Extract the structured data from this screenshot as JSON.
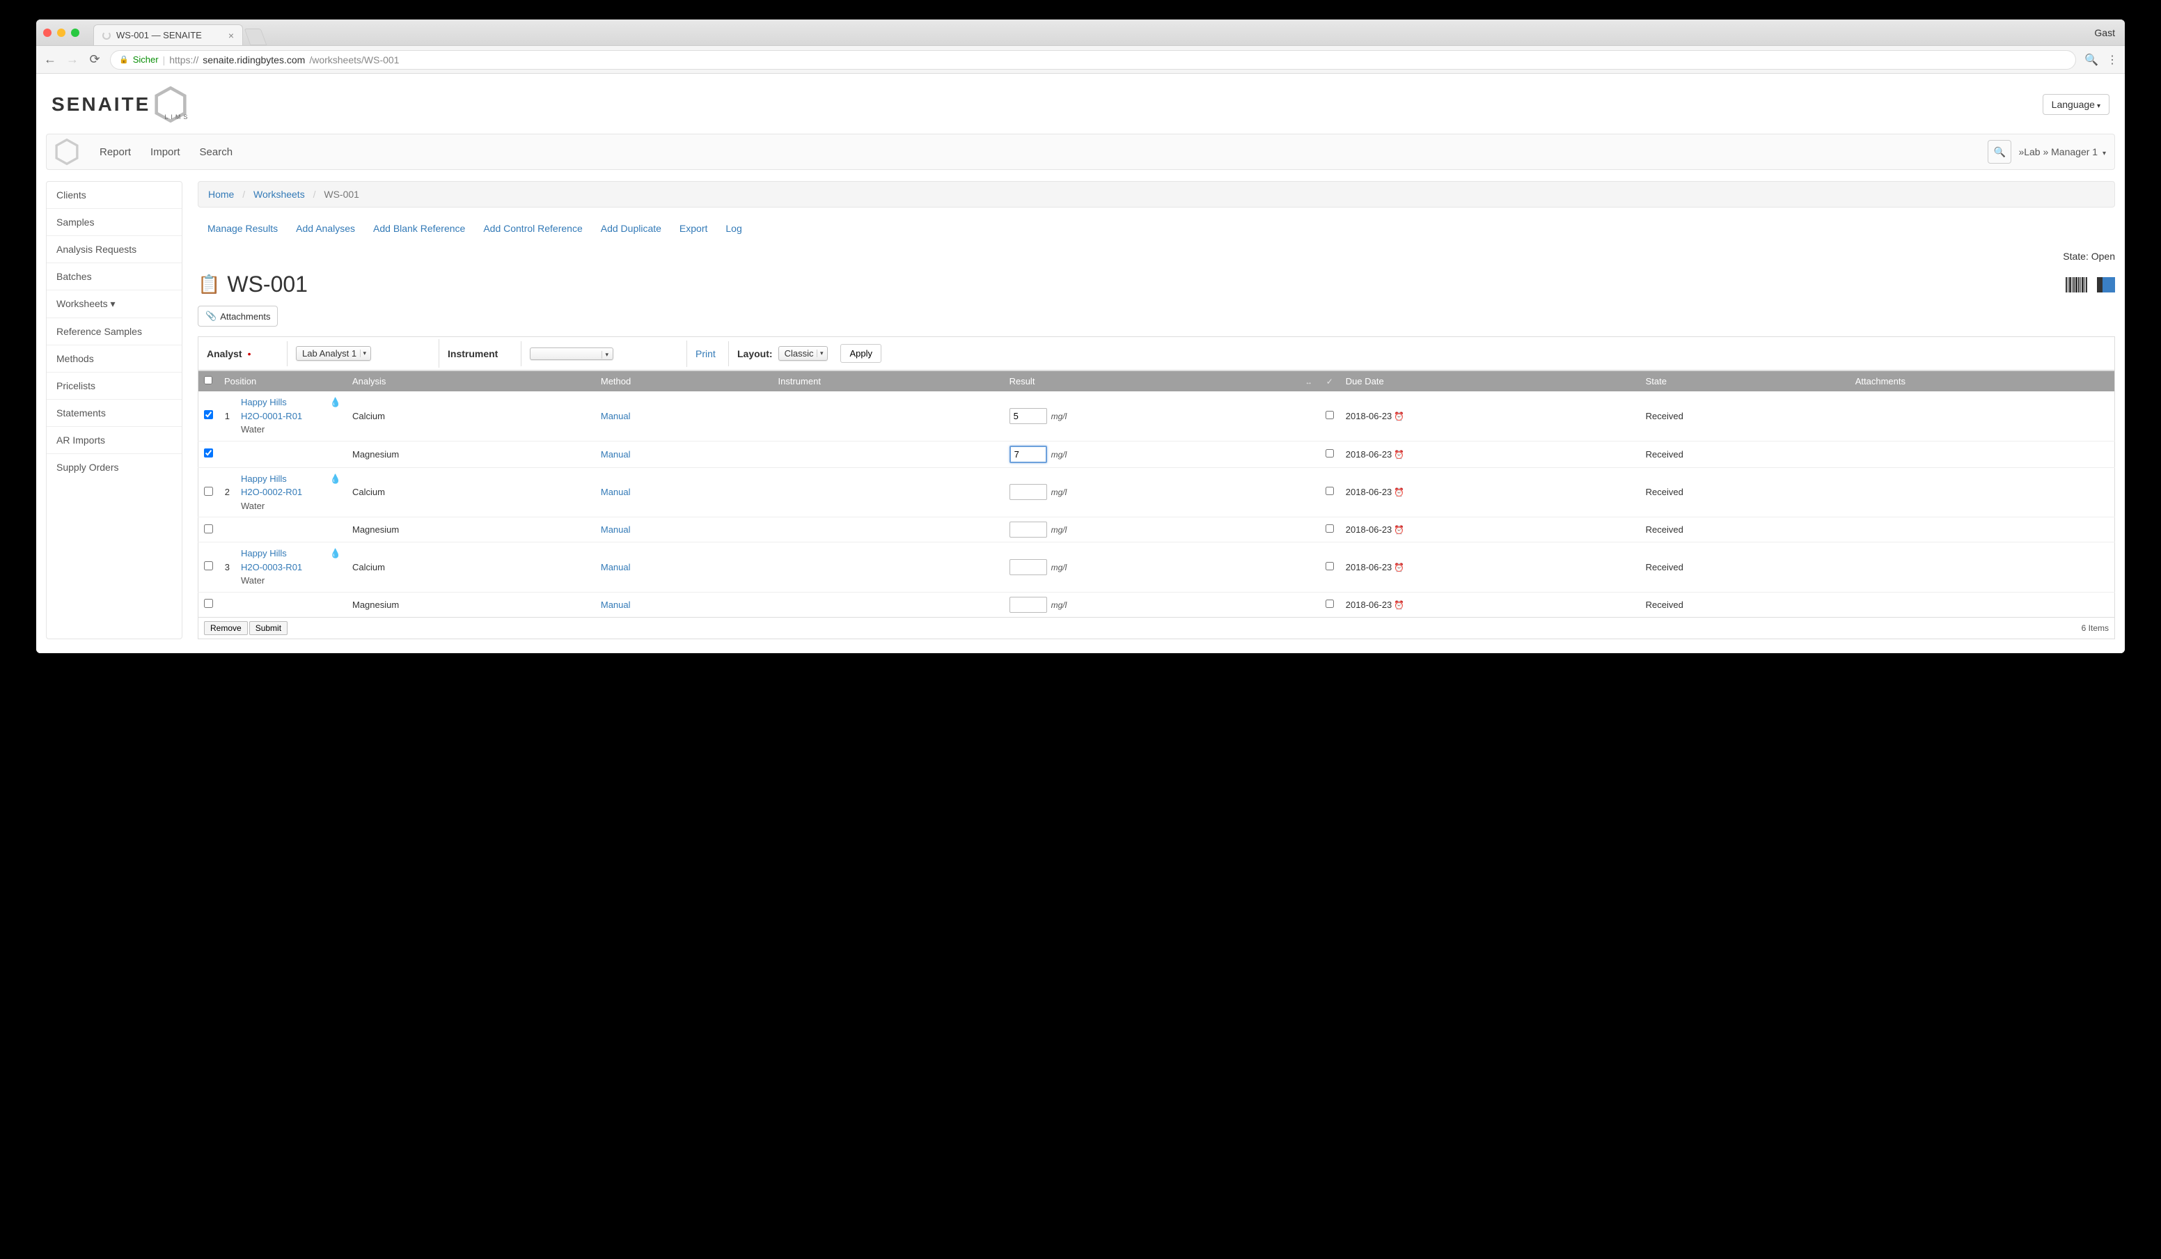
{
  "browser": {
    "tab_title": "WS-001 — SENAITE",
    "user_label": "Gast",
    "url_secure": "Sicher",
    "url_proto": "https://",
    "url_host": "senaite.ridingbytes.com",
    "url_path": "/worksheets/WS-001"
  },
  "header": {
    "logo_text": "SENAITE",
    "logo_sub": "LIMS",
    "language_btn": "Language"
  },
  "navbar": {
    "links": [
      "Report",
      "Import",
      "Search"
    ],
    "user": "»Lab » Manager 1"
  },
  "sidebar": {
    "items": [
      "Clients",
      "Samples",
      "Analysis Requests",
      "Batches",
      "Worksheets ▾",
      "Reference Samples",
      "Methods",
      "Pricelists",
      "Statements",
      "AR Imports",
      "Supply Orders"
    ]
  },
  "breadcrumb": {
    "home": "Home",
    "worksheets": "Worksheets",
    "current": "WS-001"
  },
  "action_tabs": [
    "Manage Results",
    "Add Analyses",
    "Add Blank Reference",
    "Add Control Reference",
    "Add Duplicate",
    "Export",
    "Log"
  ],
  "state_label": "State: Open",
  "page_title": "WS-001",
  "attachments_btn": "Attachments",
  "form": {
    "analyst_label": "Analyst",
    "analyst_value": "Lab Analyst 1",
    "instrument_label": "Instrument",
    "instrument_value": "",
    "print": "Print",
    "layout_label": "Layout:",
    "layout_value": "Classic",
    "apply": "Apply"
  },
  "table": {
    "headers": {
      "position": "Position",
      "analysis": "Analysis",
      "method": "Method",
      "instrument": "Instrument",
      "result": "Result",
      "due_date": "Due Date",
      "state": "State",
      "attachments": "Attachments"
    },
    "rows": [
      {
        "checked": true,
        "pos": "1",
        "client": "Happy Hills",
        "sample_id": "H2O-0001-R01",
        "sample_type": "Water",
        "analysis": "Calcium",
        "method": "Manual",
        "result": "5",
        "result_active": false,
        "unit": "mg/l",
        "due": "2018-06-23",
        "state": "Received",
        "show_sample": true
      },
      {
        "checked": true,
        "pos": "",
        "client": "",
        "sample_id": "",
        "sample_type": "",
        "analysis": "Magnesium",
        "method": "Manual",
        "result": "7",
        "result_active": true,
        "unit": "mg/l",
        "due": "2018-06-23",
        "state": "Received",
        "show_sample": false
      },
      {
        "checked": false,
        "pos": "2",
        "client": "Happy Hills",
        "sample_id": "H2O-0002-R01",
        "sample_type": "Water",
        "analysis": "Calcium",
        "method": "Manual",
        "result": "",
        "result_active": false,
        "unit": "mg/l",
        "due": "2018-06-23",
        "state": "Received",
        "show_sample": true
      },
      {
        "checked": false,
        "pos": "",
        "client": "",
        "sample_id": "",
        "sample_type": "",
        "analysis": "Magnesium",
        "method": "Manual",
        "result": "",
        "result_active": false,
        "unit": "mg/l",
        "due": "2018-06-23",
        "state": "Received",
        "show_sample": false
      },
      {
        "checked": false,
        "pos": "3",
        "client": "Happy Hills",
        "sample_id": "H2O-0003-R01",
        "sample_type": "Water",
        "analysis": "Calcium",
        "method": "Manual",
        "result": "",
        "result_active": false,
        "unit": "mg/l",
        "due": "2018-06-23",
        "state": "Received",
        "show_sample": true
      },
      {
        "checked": false,
        "pos": "",
        "client": "",
        "sample_id": "",
        "sample_type": "",
        "analysis": "Magnesium",
        "method": "Manual",
        "result": "",
        "result_active": false,
        "unit": "mg/l",
        "due": "2018-06-23",
        "state": "Received",
        "show_sample": false
      }
    ],
    "footer": {
      "remove": "Remove",
      "submit": "Submit",
      "count": "6 Items"
    }
  }
}
